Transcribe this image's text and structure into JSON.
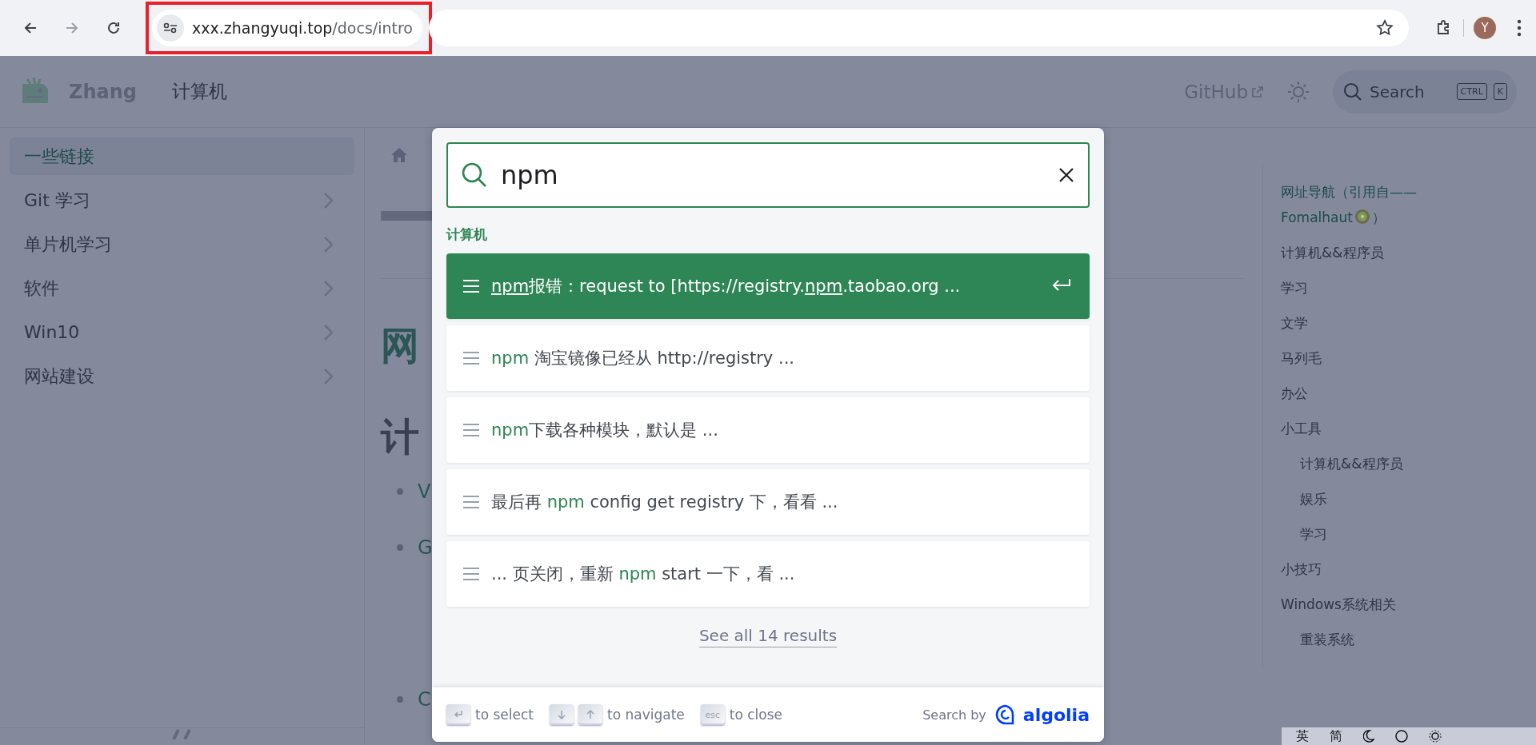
{
  "browser": {
    "url_host": "xxx.zhangyuqi.top",
    "url_path": "/docs/intro",
    "avatar": "Y"
  },
  "navbar": {
    "brand": "Zhang",
    "links": [
      "计算机"
    ],
    "github": "GitHub",
    "search_placeholder": "Search",
    "search_keys": [
      "CTRL",
      "K"
    ]
  },
  "sidebar": {
    "items": [
      {
        "label": "一些链接",
        "selected": true,
        "expandable": false
      },
      {
        "label": "Git 学习",
        "selected": false,
        "expandable": true
      },
      {
        "label": "单片机学习",
        "selected": false,
        "expandable": true
      },
      {
        "label": "软件",
        "selected": false,
        "expandable": true
      },
      {
        "label": "Win10",
        "selected": false,
        "expandable": true
      },
      {
        "label": "网站建设",
        "selected": false,
        "expandable": true
      }
    ]
  },
  "content": {
    "heading_1": "网",
    "heading_2": "计",
    "bullets": [
      "V",
      "G",
      "C"
    ]
  },
  "toc": {
    "items": [
      {
        "label": "网址导航（引用自——Fomalhaut",
        "label_end": "）",
        "active": true
      },
      {
        "label": "计算机&&程序员",
        "active": false
      },
      {
        "label": "学习",
        "active": false
      },
      {
        "label": "文学",
        "active": false
      },
      {
        "label": "马列毛",
        "active": false
      },
      {
        "label": "办公",
        "active": false
      },
      {
        "label": "小工具",
        "active": false,
        "children": [
          {
            "label": "计算机&&程序员",
            "active": false
          },
          {
            "label": "娱乐",
            "active": false
          },
          {
            "label": "学习",
            "active": false
          }
        ]
      },
      {
        "label": "小技巧",
        "active": false
      },
      {
        "label": "Windows系统相关",
        "active": false,
        "children": [
          {
            "label": "重装系统",
            "active": false
          }
        ]
      }
    ]
  },
  "search_modal": {
    "query": "npm",
    "section": "计算机",
    "hits": [
      {
        "selected": true,
        "parts": [
          {
            "text": "npm",
            "match": true
          },
          {
            "text": "报错：request to [https://registry.",
            "match": false
          },
          {
            "text": "npm",
            "match": true
          },
          {
            "text": ".taobao.org ...",
            "match": false
          }
        ]
      },
      {
        "selected": false,
        "parts": [
          {
            "text": "npm",
            "match": true
          },
          {
            "text": " 淘宝镜像已经从 http://registry ...",
            "match": false
          }
        ]
      },
      {
        "selected": false,
        "parts": [
          {
            "text": "npm",
            "match": true
          },
          {
            "text": "下载各种模块，默认是 ...",
            "match": false
          }
        ]
      },
      {
        "selected": false,
        "parts": [
          {
            "text": "最后再 ",
            "match": false
          },
          {
            "text": "npm",
            "match": true
          },
          {
            "text": " config get registry 下，看看 ...",
            "match": false
          }
        ]
      },
      {
        "selected": false,
        "parts": [
          {
            "text": "... 页关闭，重新 ",
            "match": false
          },
          {
            "text": "npm",
            "match": true
          },
          {
            "text": " start 一下，看 ...",
            "match": false
          }
        ]
      }
    ],
    "see_all": "See all 14 results",
    "footer": {
      "hints": [
        {
          "keys": [
            {
              "kind": "enter"
            }
          ],
          "label": "to select"
        },
        {
          "keys": [
            {
              "kind": "down"
            },
            {
              "kind": "up"
            }
          ],
          "label": "to navigate"
        },
        {
          "keys": [
            {
              "kind": "text",
              "text": "esc"
            }
          ],
          "label": "to close"
        }
      ],
      "search_by": "Search by",
      "logo": "algolia"
    }
  },
  "ime_bar": {
    "items": [
      "英",
      "简"
    ]
  }
}
